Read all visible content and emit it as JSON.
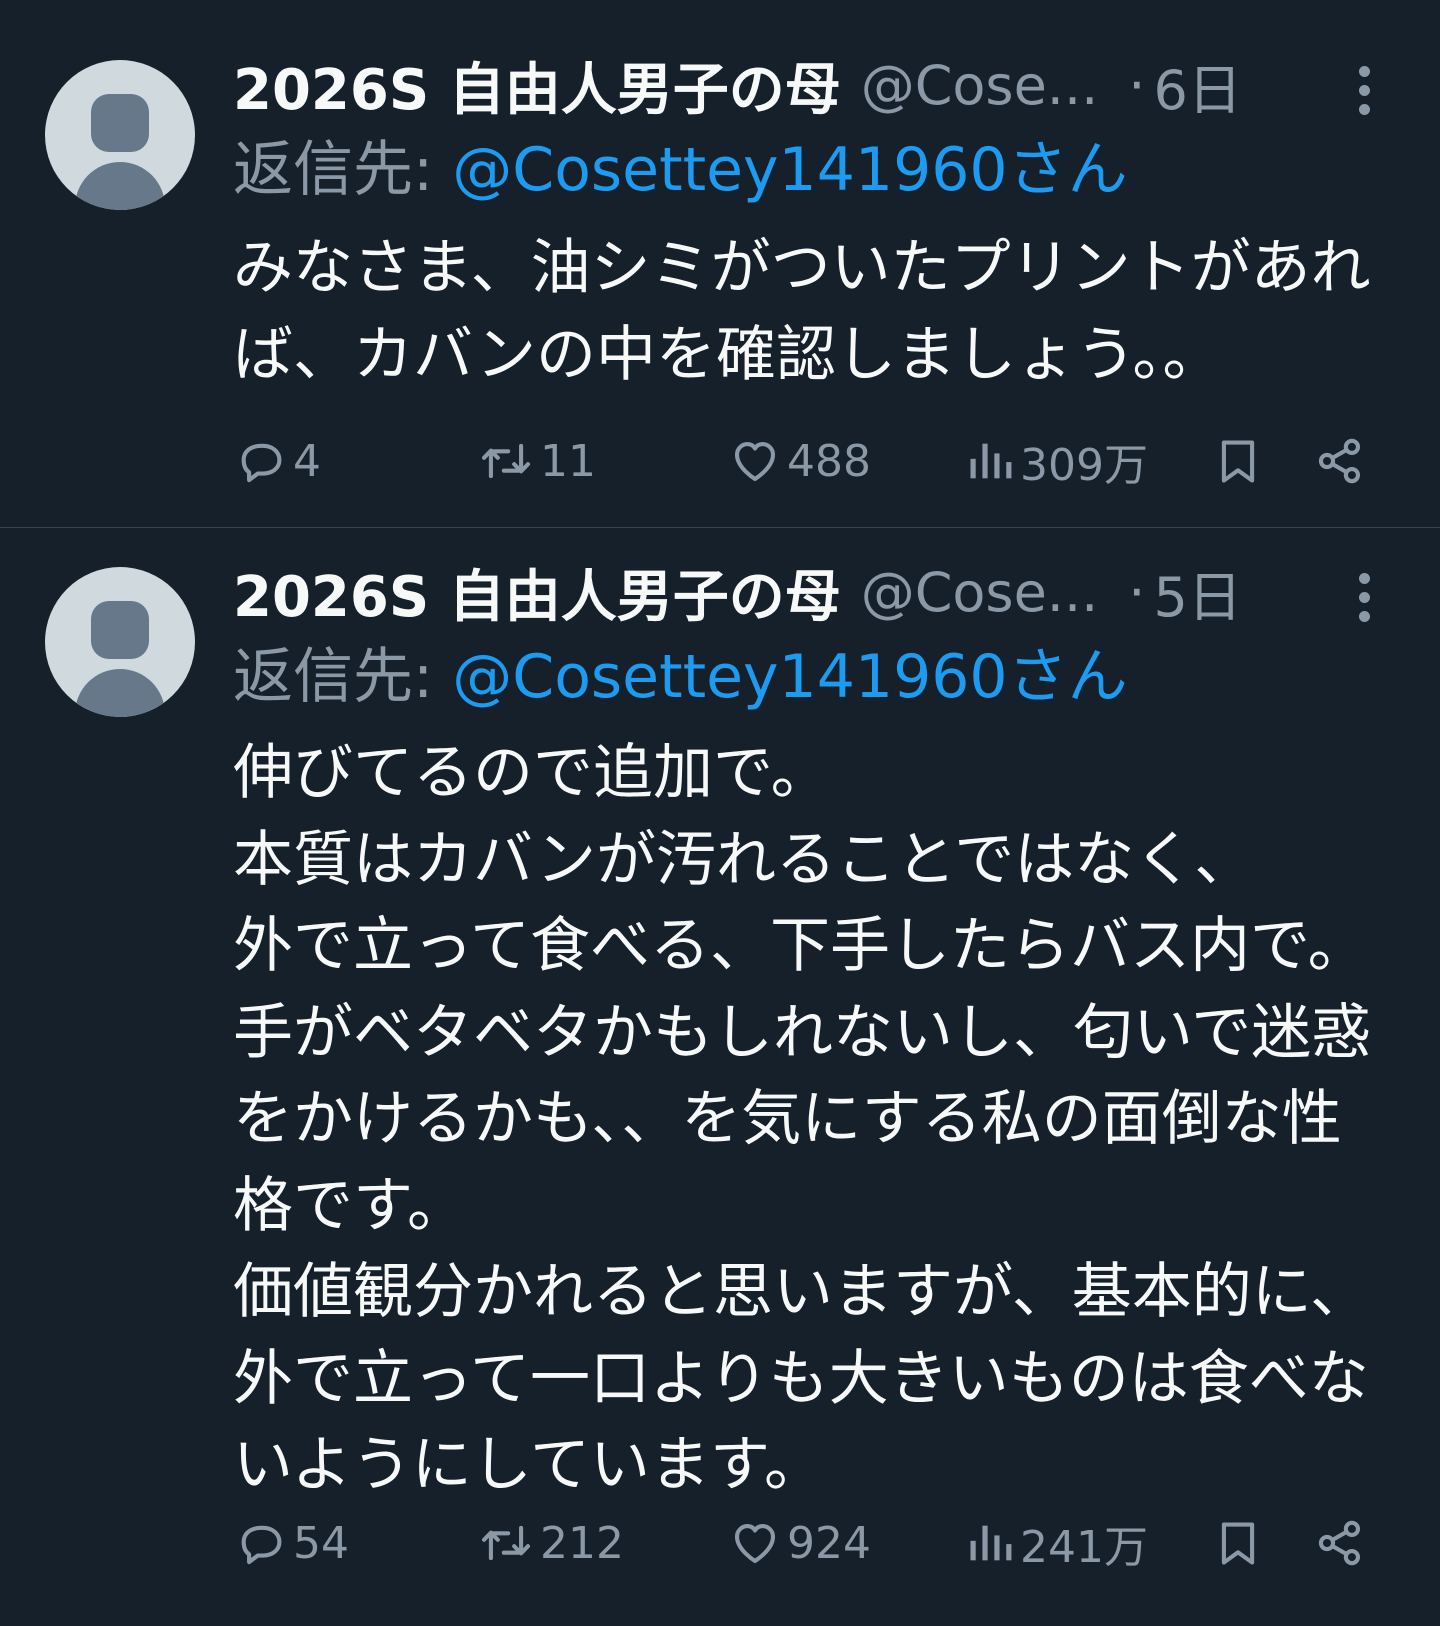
{
  "tweets": [
    {
      "display_name": "2026S 自由人男子の母",
      "handle": "@Cose...",
      "separator": "·",
      "time": "6日",
      "reply_prefix": "返信先: ",
      "reply_to": "@Cosettey141960さん",
      "text_lines": [
        "みなさま、油シミがついたプリントがあれ",
        "ば、カバンの中を確認しましょう。。"
      ],
      "metrics": {
        "replies": "4",
        "retweets": "11",
        "likes": "488",
        "views": "309万"
      }
    },
    {
      "display_name": "2026S 自由人男子の母",
      "handle": "@Cose...",
      "separator": "·",
      "time": "5日",
      "reply_prefix": "返信先: ",
      "reply_to": "@Cosettey141960さん",
      "text_lines": [
        "伸びてるので追加で。",
        "本質はカバンが汚れることではなく、",
        "外で立って食べる、下手したらバス内で。",
        "手がベタベタかもしれないし、匂いで迷惑",
        "をかけるかも、、を気にする私の面倒な性",
        "格です。",
        "価値観分かれると思いますが、基本的に、",
        "外で立って一口よりも大きいものは食べな",
        "いようにしています。"
      ],
      "metrics": {
        "replies": "54",
        "retweets": "212",
        "likes": "924",
        "views": "241万"
      }
    }
  ],
  "icons": {
    "reply": "speech-bubble-icon",
    "retweet": "retweet-arrows-icon",
    "like": "heart-icon",
    "views": "bar-chart-icon",
    "bookmark": "bookmark-icon",
    "share": "share-nodes-icon",
    "more": "more-vertical-icon"
  },
  "colors": {
    "background": "#15202b",
    "text": "#f7f9f9",
    "muted": "#8b98a5",
    "accent": "#1d9bf0",
    "divider": "#38444d",
    "avatar_bg": "#cfd9de",
    "avatar_fg": "#66788a"
  }
}
